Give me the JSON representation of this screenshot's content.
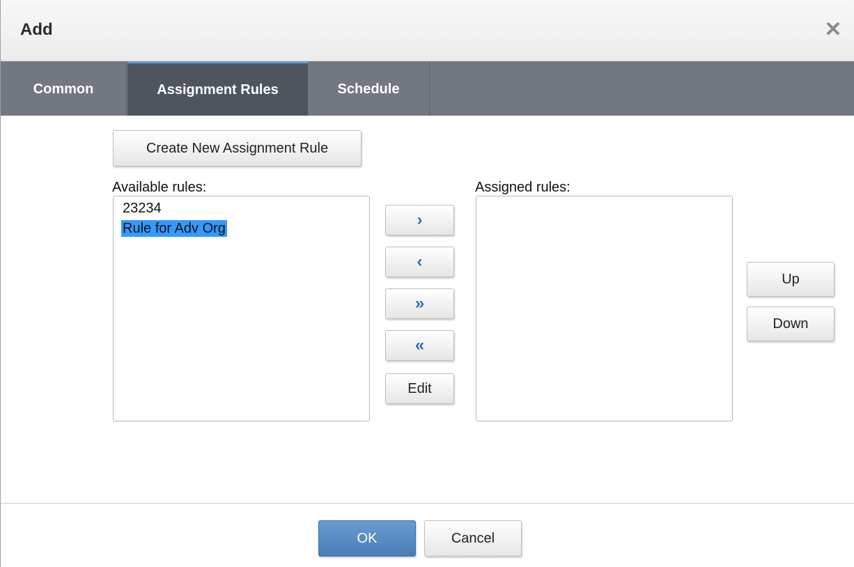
{
  "dialog": {
    "title": "Add",
    "close_glyph": "✕"
  },
  "tabs": [
    {
      "label": "Common",
      "active": false
    },
    {
      "label": "Assignment Rules",
      "active": true
    },
    {
      "label": "Schedule",
      "active": false
    }
  ],
  "create_button": "Create New Assignment Rule",
  "available": {
    "label": "Available rules:",
    "items": [
      "23234",
      "Rule for Adv Org"
    ],
    "selected_index": 1
  },
  "assigned": {
    "label": "Assigned rules:",
    "items": []
  },
  "transfer": {
    "add_one": "›",
    "remove_one": "‹",
    "add_all": "»",
    "remove_all": "«",
    "edit": "Edit"
  },
  "order": {
    "up": "Up",
    "down": "Down"
  },
  "footer": {
    "ok": "OK",
    "cancel": "Cancel"
  },
  "colors": {
    "accent": "#4a7eb8",
    "tab_bar": "#737880",
    "tab_active": "#4f555d",
    "selection": "#3399ff",
    "arrow": "#2f6fb3"
  }
}
